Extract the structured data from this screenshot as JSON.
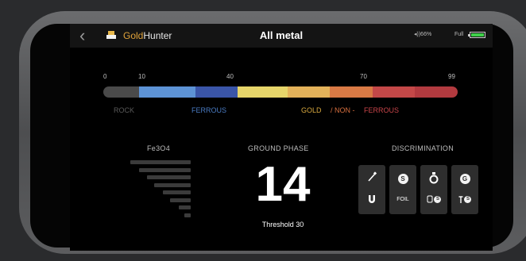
{
  "header": {
    "brand_gold": "Gold",
    "brand_hunter": "Hunter",
    "mode_title": "All metal",
    "volume_text": "◂))66%",
    "battery_text": "Full"
  },
  "scale": {
    "ticks": [
      "0",
      "10",
      "40",
      "70",
      "99"
    ],
    "zones": [
      {
        "label": "ROCK",
        "color": "#5a5a5a"
      },
      {
        "label": "FERROUS",
        "color": "#4a7cc4"
      },
      {
        "label": "GOLD",
        "color": "#d9a93f"
      },
      {
        "label": "/ NON -",
        "color": "#d9703f"
      },
      {
        "label": "FERROUS",
        "color": "#c9454a"
      }
    ],
    "segment_colors": [
      "#4a4a4a",
      "#5d93d6",
      "#3a55a8",
      "#e6d56a",
      "#e3b25a",
      "#d97a45",
      "#c44848",
      "#b23a3f"
    ]
  },
  "fe3o4": {
    "title": "Fe3O4",
    "levels": [
      1.0,
      0.86,
      0.72,
      0.6,
      0.46,
      0.34,
      0.2,
      0.1
    ]
  },
  "ground_phase": {
    "title": "GROUND PHASE",
    "value": "14",
    "threshold": "Threshold 30"
  },
  "discrimination": {
    "title": "DISCRIMINATION",
    "items": [
      {
        "name": "nail-magnet",
        "top_icon": "nail-icon",
        "bottom_icon": "magnet-icon",
        "bottom_text": ""
      },
      {
        "name": "coin-foil",
        "top_icon": "coin-icon",
        "top_letter": "S",
        "bottom_text": "FOIL"
      },
      {
        "name": "ring-can",
        "top_icon": "ring-icon",
        "bottom_icon": "can-coin-icon",
        "bottom_letter": "S"
      },
      {
        "name": "gold-coin-pull",
        "top_icon": "gold-coin-icon",
        "top_letter": "G",
        "bottom_icon": "pulltab-icon",
        "bottom_letter": "S"
      }
    ]
  }
}
